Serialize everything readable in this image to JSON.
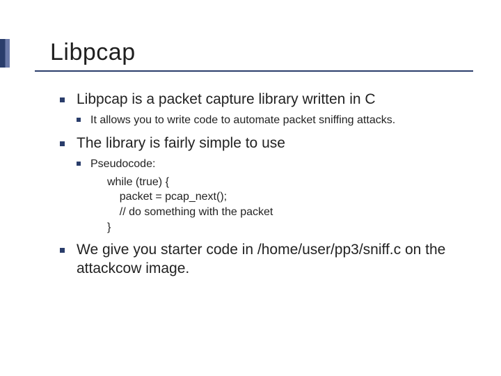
{
  "title": "Libpcap",
  "bullets": {
    "item1": {
      "text": "Libpcap is a packet capture library written in C",
      "sub1": "It allows you to write code to automate packet sniffing attacks."
    },
    "item2": {
      "text": "The library is fairly simple to use",
      "sub1": "Pseudocode:",
      "code": "while (true) {\n    packet = pcap_next();\n    // do something with the packet\n}"
    },
    "item3": {
      "text": "We give you starter code in /home/user/pp3/sniff.c on the attackcow image."
    }
  }
}
